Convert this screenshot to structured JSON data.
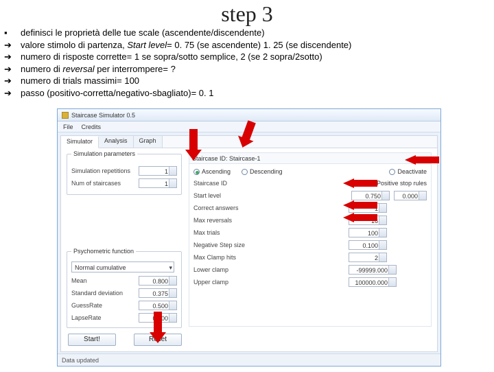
{
  "title": "step 3",
  "bullets": [
    {
      "marker": "▪",
      "text": "definisci le proprietà delle tue scale (ascendente/discendente)"
    },
    {
      "marker": "➔",
      "html": "valore stimolo di partenza, <i>Start level</i>= 0. 75 (se ascendente) 1. 25 (se discendente)"
    },
    {
      "marker": "➔",
      "text": "numero di risposte corrette= 1 se sopra/sotto semplice, 2 (se 2 sopra/2sotto)"
    },
    {
      "marker": "➔",
      "html": "numero di <i>reversal</i> per interrompere= ?"
    },
    {
      "marker": "➔",
      "text": "numero di trials massimi= 100"
    },
    {
      "marker": "➔",
      "text": "passo (positivo-corretta/negativo-sbagliato)= 0. 1"
    }
  ],
  "app": {
    "window_title": "Staircase Simulator 0.5",
    "menu": [
      "File",
      "Credits"
    ],
    "tabs": [
      "Simulator",
      "Analysis",
      "Graph"
    ],
    "status": "Data updated",
    "sim": {
      "group_label": "Simulation parameters",
      "rep_label": "Simulation repetitions",
      "rep_val": "1",
      "num_label": "Num of staircases",
      "num_val": "1"
    },
    "psy": {
      "group_label": "Psychometric function",
      "combo_val": "Normal cumulative",
      "mean_label": "Mean",
      "mean_val": "0.800",
      "sd_label": "Standard deviation",
      "sd_val": "0.375",
      "guess_label": "GuessRate",
      "guess_val": "0.500",
      "lapse_label": "LapseRate",
      "lapse_val": "0.000"
    },
    "buttons": {
      "start": "Start!",
      "reset": "Reset"
    },
    "sc": {
      "header": "Staircase ID: Staircase-1",
      "asc_label": "Ascending",
      "desc_label": "Descending",
      "deact_label": "Deactivate",
      "posrule_label": "Positive stop rules",
      "start_label": "Start level",
      "start_val": "0.750",
      "start_unit": "0.000",
      "corr_label": "Correct answers",
      "corr_val": "1",
      "rev_label": "Max reversals",
      "rev_val": "16",
      "trials_label": "Max trials",
      "trials_val": "100",
      "neg_label": "Negative Step size",
      "neg_val": "0.100",
      "clamp_label": "Max Clamp hits",
      "clamp_val": "2",
      "low_label": "Lower clamp",
      "low_val": "-99999.000",
      "up_label": "Upper clamp",
      "up_val": "100000.000"
    }
  }
}
